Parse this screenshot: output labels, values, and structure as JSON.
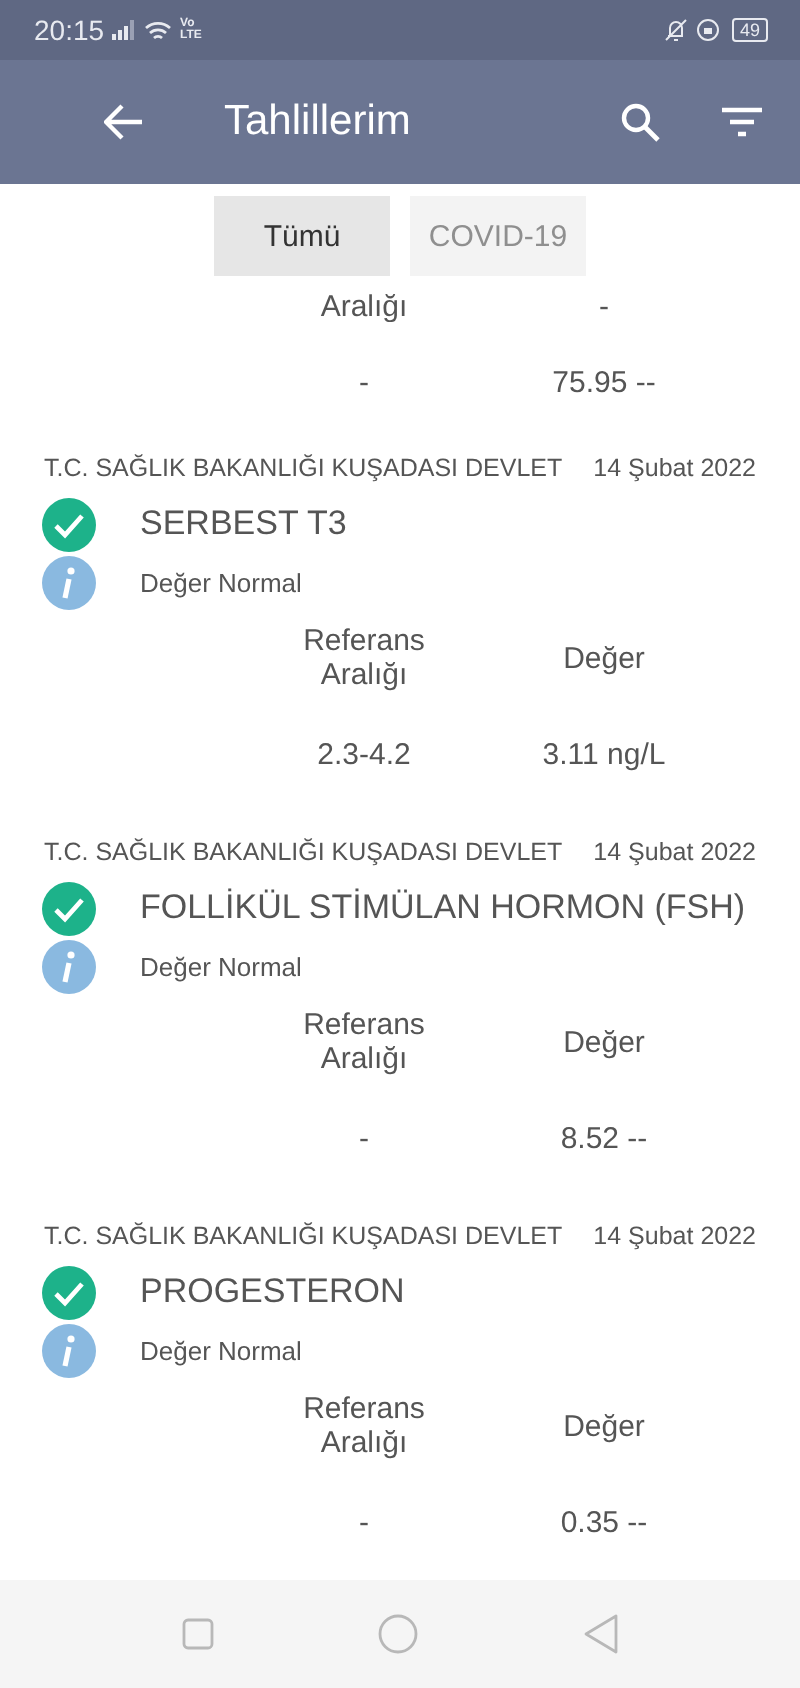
{
  "status_bar": {
    "time": "20:15",
    "network": "Vo LTE",
    "battery": "49"
  },
  "app_bar": {
    "title": "Tahlillerim"
  },
  "tabs": [
    {
      "label": "Tümü",
      "selected": true
    },
    {
      "label": "COVID-19",
      "selected": false
    }
  ],
  "partial_result": {
    "column_headers": [
      "Aralığı",
      "-"
    ],
    "values": [
      "-",
      "75.95 --"
    ]
  },
  "results": [
    {
      "institution": "T.C. SAĞLIK BAKANLIĞI KUŞADASI DEVLET",
      "date": "14 Şubat 2022",
      "test_name": "SERBEST T3",
      "normal": true,
      "note": "Değer Normal",
      "column_headers": [
        "Referans Aralığı",
        "Değer"
      ],
      "values": [
        "2.3-4.2",
        "3.11 ng/L"
      ]
    },
    {
      "institution": "T.C. SAĞLIK BAKANLIĞI KUŞADASI DEVLET",
      "date": "14 Şubat 2022",
      "test_name": "FOLLİKÜL STİMÜLAN HORMON (FSH)",
      "normal": true,
      "note": "Değer Normal",
      "column_headers": [
        "Referans Aralığı",
        "Değer"
      ],
      "values": [
        "-",
        "8.52 --"
      ]
    },
    {
      "institution": "T.C. SAĞLIK BAKANLIĞI KUŞADASI DEVLET",
      "date": "14 Şubat 2022",
      "test_name": "PROGESTERON",
      "normal": true,
      "note": "Değer Normal",
      "column_headers": [
        "Referans Aralığı",
        "Değer"
      ],
      "values": [
        "-",
        "0.35 --"
      ]
    }
  ]
}
